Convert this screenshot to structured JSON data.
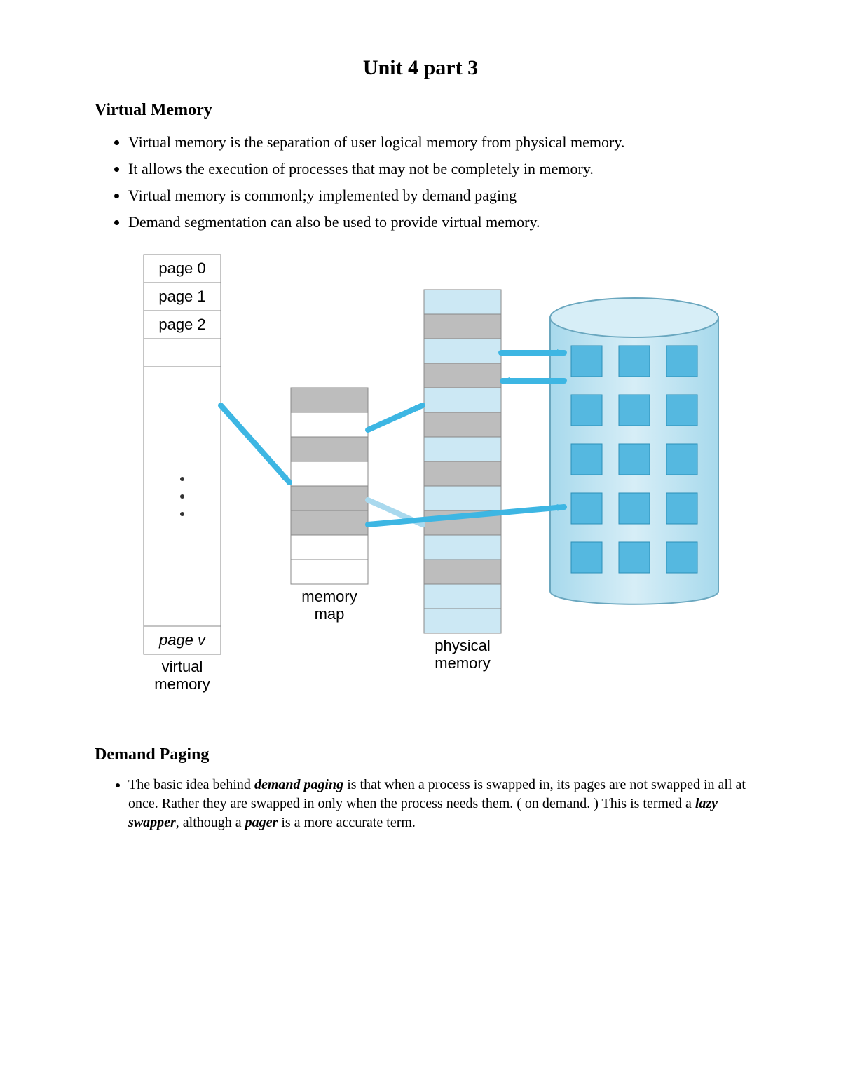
{
  "page": {
    "title": "Unit 4 part 3",
    "sections": {
      "vm": {
        "heading": "Virtual Memory",
        "bullets": [
          "Virtual memory is the separation of user logical memory from physical memory.",
          "It allows the execution of processes that may not be completely in memory.",
          "Virtual memory is commonl;y implemented by demand paging",
          "Demand segmentation can also be used to provide virtual memory."
        ]
      },
      "dp": {
        "heading": "Demand Paging",
        "bullet_html": "The basic idea behind <span class='em1'>demand paging</span> is that when a process is swapped in, its pages are not swapped in all at once. Rather they are swapped in only when the process needs them. ( on demand. ) This is termed a <span class='em1'>lazy swapper</span>, although a <span class='em1'>pager</span> is a more accurate term."
      }
    }
  },
  "diagram": {
    "labels": {
      "page0": "page 0",
      "page1": "page 1",
      "page2": "page 2",
      "pagev": "page v",
      "virtual_memory": "virtual memory",
      "memory_map": "memory map",
      "physical_memory": "physical memory"
    },
    "colors": {
      "light_blue": "#cce8f4",
      "grey": "#bdbdbd",
      "cyl_fill": "#bfe5f3",
      "cyl_stroke": "#6aa7bf",
      "tile": "#55b8e0",
      "arrow": "#3db6e3"
    }
  }
}
